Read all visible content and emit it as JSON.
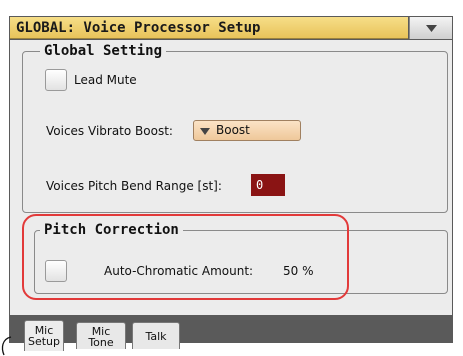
{
  "window": {
    "title": "GLOBAL: Voice Processor Setup"
  },
  "global_setting": {
    "legend": "Global Setting",
    "lead_mute_label": "Lead Mute",
    "vibrato_label": "Voices Vibrato Boost:",
    "vibrato_value": "Boost",
    "pitch_bend_label": "Voices Pitch Bend Range [st]:",
    "pitch_bend_value": "0"
  },
  "pitch_correction": {
    "legend": "Pitch Correction",
    "auto_chromatic_label": "Auto-Chromatic Amount:",
    "auto_chromatic_value": "50 %"
  },
  "tabs": [
    {
      "line1": "Mic",
      "line2": "Setup",
      "active": true
    },
    {
      "line1": "Mic",
      "line2": "Tone",
      "active": false
    },
    {
      "line1": "Talk",
      "line2": "",
      "active": false
    }
  ],
  "colors": {
    "title_bar": "#f0d070",
    "value_box": "#8a1414",
    "highlight": "#e23a3a",
    "dropdown": "#f5d5ae"
  },
  "icons": {
    "menu": "triangle-down",
    "dropdown": "triangle-down"
  }
}
